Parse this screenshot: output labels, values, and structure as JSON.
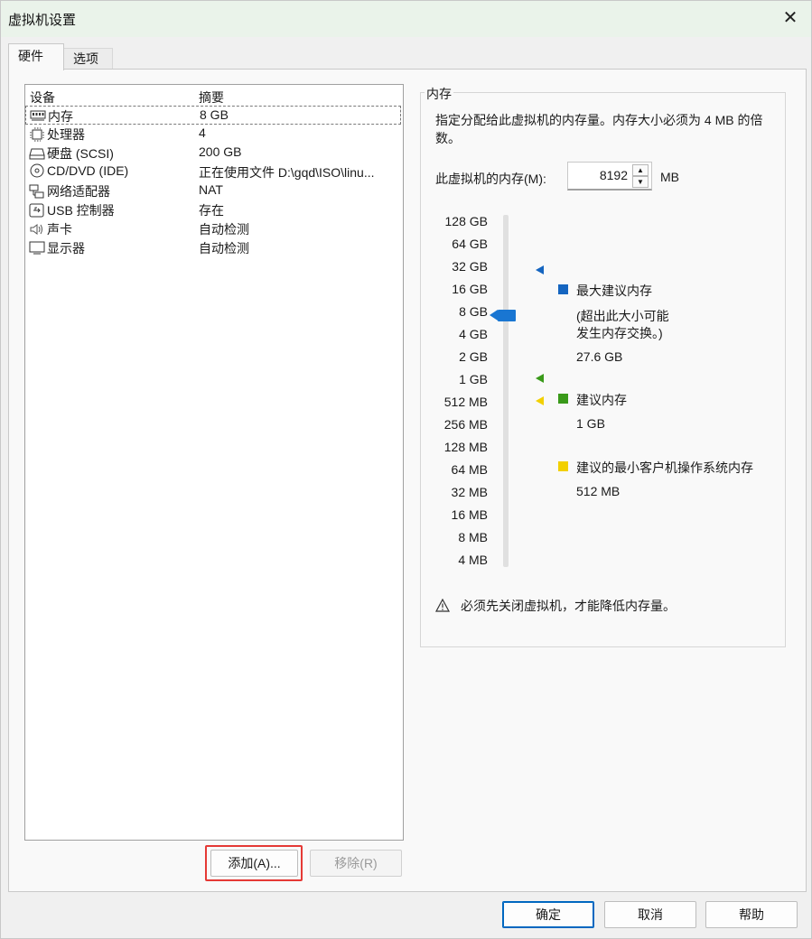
{
  "window": {
    "title": "虚拟机设置",
    "close_glyph": "✕"
  },
  "tabs": [
    {
      "label": "硬件"
    },
    {
      "label": "选项"
    }
  ],
  "device_list": {
    "headers": {
      "device": "设备",
      "summary": "摘要"
    },
    "rows": [
      {
        "icon": "memory-icon",
        "name": "内存",
        "summary": "8 GB"
      },
      {
        "icon": "processor-icon",
        "name": "处理器",
        "summary": "4"
      },
      {
        "icon": "hard-disk-icon",
        "name": "硬盘 (SCSI)",
        "summary": "200 GB"
      },
      {
        "icon": "cd-dvd-icon",
        "name": "CD/DVD (IDE)",
        "summary": "正在使用文件 D:\\gqd\\ISO\\linu..."
      },
      {
        "icon": "network-adapter-icon",
        "name": "网络适配器",
        "summary": "NAT"
      },
      {
        "icon": "usb-icon",
        "name": "USB 控制器",
        "summary": "存在"
      },
      {
        "icon": "sound-card-icon",
        "name": "声卡",
        "summary": "自动检测"
      },
      {
        "icon": "display-icon",
        "name": "显示器",
        "summary": "自动检测"
      }
    ],
    "add_button": "添加(A)...",
    "remove_button": "移除(R)"
  },
  "memory": {
    "group_title": "内存",
    "description": "指定分配给此虚拟机的内存量。内存大小必须为 4 MB 的倍数。",
    "field_label": "此虚拟机的内存(M):",
    "value": "8192",
    "unit": "MB",
    "scale": [
      "128 GB",
      "64 GB",
      "32 GB",
      "16 GB",
      "8 GB",
      "4 GB",
      "2 GB",
      "1 GB",
      "512 MB",
      "256 MB",
      "128 MB",
      "64 MB",
      "32 MB",
      "16 MB",
      "8 MB",
      "4 MB"
    ],
    "slider_value": "8 GB",
    "legend": {
      "max": {
        "label": "最大建议内存",
        "note_line1": "(超出此大小可能",
        "note_line2": "发生内存交换。)",
        "value": "27.6 GB",
        "color": "#1565c0"
      },
      "recommended": {
        "label": "建议内存",
        "value": "1 GB",
        "color": "#3a9a1a"
      },
      "min_guest": {
        "label": "建议的最小客户机操作系统内存",
        "value": "512 MB",
        "color": "#f2d000"
      }
    },
    "warning": "必须先关闭虚拟机，才能降低内存量。"
  },
  "footer": {
    "ok": "确定",
    "cancel": "取消",
    "help": "帮助"
  }
}
